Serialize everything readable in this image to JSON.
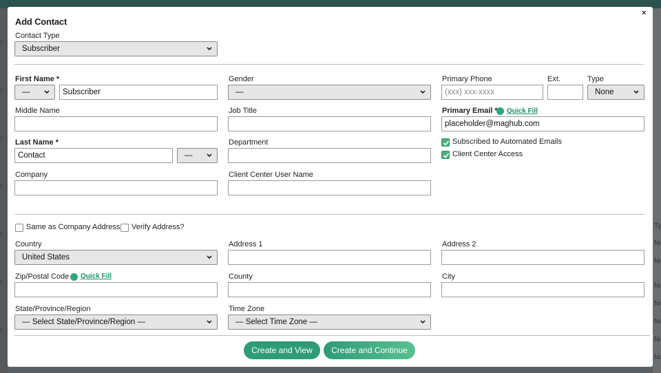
{
  "modal": {
    "title": "Add Contact",
    "close_label": "×",
    "contact_type": {
      "label": "Contact Type",
      "value": "Subscriber"
    },
    "first_name": {
      "label": "First Name *",
      "prefix_value": "—",
      "value": "Subscriber"
    },
    "middle_name": {
      "label": "Middle Name",
      "value": ""
    },
    "last_name": {
      "label": "Last Name *",
      "value": "Contact",
      "suffix_value": "—"
    },
    "company": {
      "label": "Company",
      "value": ""
    },
    "gender": {
      "label": "Gender",
      "value": "—"
    },
    "job_title": {
      "label": "Job Title",
      "value": ""
    },
    "department": {
      "label": "Department",
      "value": ""
    },
    "client_center_user_name": {
      "label": "Client Center User Name",
      "value": ""
    },
    "primary_phone": {
      "label": "Primary Phone",
      "placeholder": "(xxx) xxx-xxxx",
      "value": ""
    },
    "ext": {
      "label": "Ext.",
      "value": ""
    },
    "phone_type": {
      "label": "Type",
      "value": "None"
    },
    "primary_email": {
      "label": "Primary Email *",
      "quick_fill": "Quick Fill",
      "value": "placeholder@maghub.com"
    },
    "subscribed": {
      "label": "Subscribed to Automated Emails",
      "checked": true
    },
    "client_center_access": {
      "label": "Client Center Access",
      "checked": true
    },
    "same_as_company": {
      "label": "Same as Company Address?",
      "checked": false
    },
    "verify_address": {
      "label": "Verify Address?",
      "checked": false
    },
    "country": {
      "label": "Country",
      "value": "United States"
    },
    "address1": {
      "label": "Address 1",
      "value": ""
    },
    "address2": {
      "label": "Address 2",
      "value": ""
    },
    "zip": {
      "label": "Zip/Postal Code",
      "quick_fill": "Quick Fill",
      "value": ""
    },
    "county": {
      "label": "County",
      "value": ""
    },
    "city": {
      "label": "City",
      "value": ""
    },
    "state": {
      "label": "State/Province/Region",
      "value": "— Select State/Province/Region —"
    },
    "time_zone": {
      "label": "Time Zone",
      "value": "— Select Time Zone —"
    },
    "buttons": {
      "create_and_view": "Create and View",
      "create_and_continue": "Create and Continue"
    }
  },
  "background": {
    "chevron": "›",
    "right_cells": [
      "Ty",
      "Nc",
      "Nc",
      "Nc",
      "Nc",
      "Nc",
      "Nc",
      "Nc"
    ]
  },
  "colors": {
    "accent": "#2e9c78",
    "accent_light": "#58c091",
    "overlay": "#5a5f63"
  }
}
